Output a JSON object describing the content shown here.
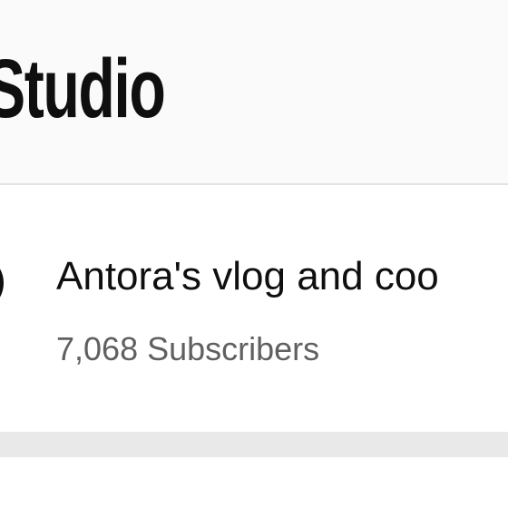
{
  "header": {
    "title": "Studio"
  },
  "channel": {
    "name": "Antora's vlog and coo",
    "subscribers": "7,068 Subscribers"
  }
}
